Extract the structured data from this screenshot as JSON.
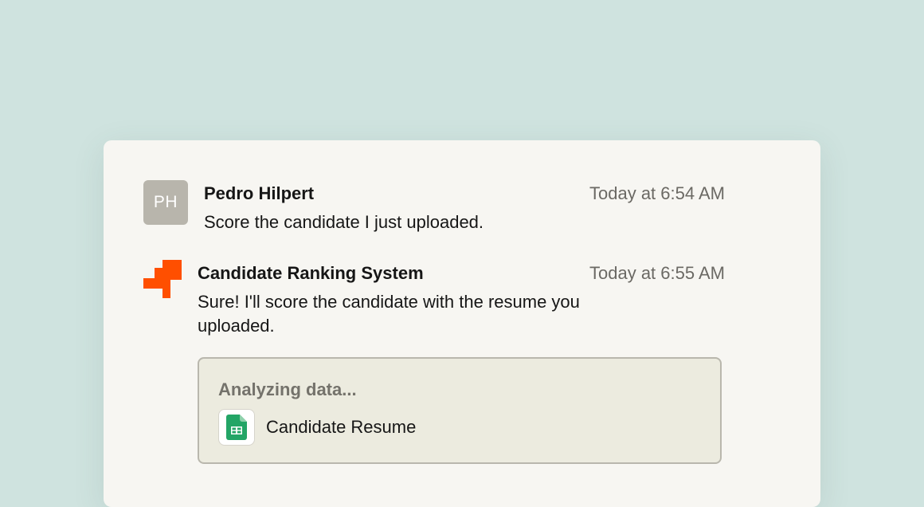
{
  "conversation": {
    "user_message": {
      "avatar_initials": "PH",
      "author": "Pedro Hilpert",
      "timestamp": "Today at 6:54 AM",
      "text": "Score the candidate I just uploaded."
    },
    "bot_message": {
      "logo_icon": "zapier-style-logo-icon",
      "author": "Candidate Ranking System",
      "timestamp": "Today at 6:55 AM",
      "text": "Sure! I'll score the candidate with the resume you uploaded.",
      "status": {
        "title": "Analyzing data...",
        "attachment": {
          "icon": "google-sheets-icon",
          "name": "Candidate Resume"
        }
      }
    }
  },
  "colors": {
    "background": "#cfe3df",
    "card": "#f7f6f2",
    "brand_orange": "#ff4f00",
    "sheets_green": "#23a566",
    "status_box": "#ecebdf"
  }
}
